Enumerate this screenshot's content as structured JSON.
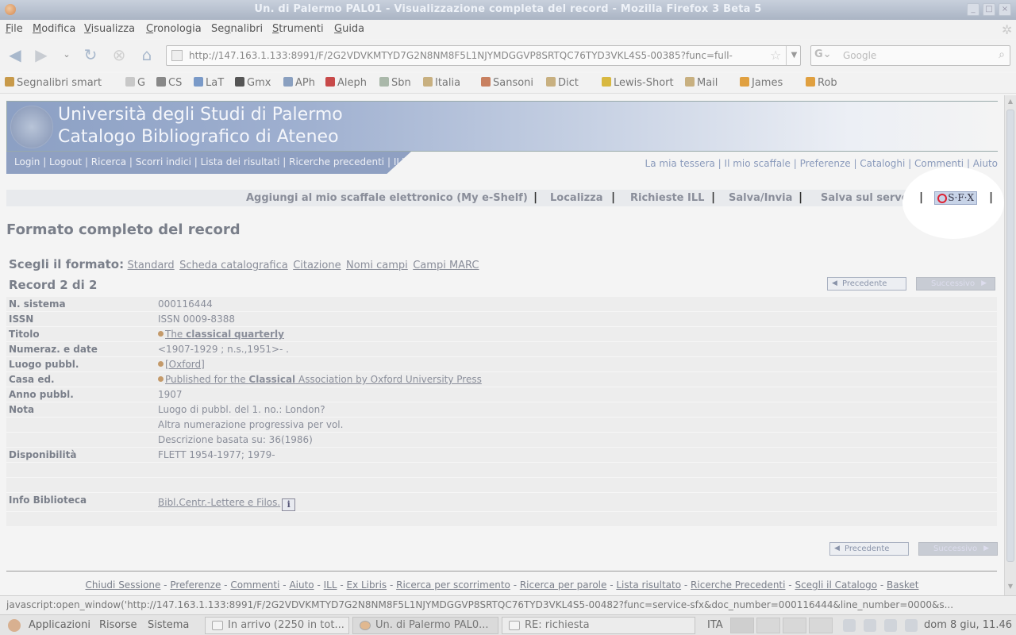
{
  "window": {
    "title": "Un. di Palermo PAL01 - Visualizzazione completa del record - Mozilla Firefox 3 Beta 5"
  },
  "menu": [
    "File",
    "Modifica",
    "Visualizza",
    "Cronologia",
    "Segnalibri",
    "Strumenti",
    "Guida"
  ],
  "menu_accel": [
    "F",
    "M",
    "V",
    "C",
    "g",
    "S",
    "G"
  ],
  "urlbar": {
    "url": "http://147.163.1.133:8991/F/2G2VDVKMTYD7G2N8NM8F5L1NJYMDGGVP8SRTQC76TYD3VKL4S5-00385?func=full-"
  },
  "searchbar": {
    "placeholder": "Google"
  },
  "bookmarks": [
    {
      "label": "Segnalibri smart",
      "icon": "bookmark-smart-icon",
      "color": "#c89a4a"
    },
    {
      "label": "G",
      "icon": "google-icon",
      "color": "#c8c8c8"
    },
    {
      "label": "CS",
      "icon": "cs-icon",
      "color": "#888888"
    },
    {
      "label": "LaT",
      "icon": "lat-icon",
      "color": "#7a9ac8"
    },
    {
      "label": "Gmx",
      "icon": "gmx-icon",
      "color": "#555555"
    },
    {
      "label": "APh",
      "icon": "aph-icon",
      "color": "#8aa0c0"
    },
    {
      "label": "Aleph",
      "icon": "aleph-icon",
      "color": "#c84a4a"
    },
    {
      "label": "Sbn",
      "icon": "sbn-icon",
      "color": "#aab8aa"
    },
    {
      "label": "Italia",
      "icon": "folder-icon",
      "color": "#c8b080"
    },
    {
      "label": "Sansoni",
      "icon": "sansoni-icon",
      "color": "#c88060"
    },
    {
      "label": "Dict",
      "icon": "folder-icon",
      "color": "#c8b080"
    },
    {
      "label": "Lewis-Short",
      "icon": "star-icon",
      "color": "#d8b840"
    },
    {
      "label": "Mail",
      "icon": "folder-icon",
      "color": "#c8b080"
    },
    {
      "label": "James",
      "icon": "rss-icon",
      "color": "#e0a040"
    },
    {
      "label": "Rob",
      "icon": "rss-icon",
      "color": "#e0a040"
    }
  ],
  "banner": {
    "line1": "Università degli Studi di Palermo",
    "line2": "Catalogo Bibliografico di Ateneo",
    "links": "Login |  Logout |  Ricerca |  Scorri indici |  Lista dei risultati |  Ricerche precedenti |  ILL",
    "toplinks": "La mia tessera |  Il mio scaffale |  Preferenze |  Cataloghi |  Commenti |  Aiuto"
  },
  "actions": {
    "eshelf": "Aggiungi al mio scaffale elettronico (My e-Shelf)",
    "localizza": "Localizza",
    "ill": "Richieste ILL",
    "salva": "Salva/Invia",
    "server": "Salva sul server",
    "sfx": "S·F·X",
    "sep": "|"
  },
  "page": {
    "title": "Formato completo del record",
    "format_label": "Scegli il formato:",
    "formats": [
      "Standard",
      "Scheda catalografica",
      "Citazione",
      "Nomi campi",
      "Campi MARC"
    ],
    "record": "Record 2 di 2",
    "prev": "Precedente",
    "next": "Successivo"
  },
  "record": {
    "n_sistema": {
      "k": "N. sistema",
      "v": "000116444"
    },
    "issn": {
      "k": "ISSN",
      "v": "ISSN 0009-8388"
    },
    "titolo": {
      "k": "Titolo",
      "a": "The ",
      "b1": "classical",
      "b2": "quarterly"
    },
    "numeraz": {
      "k": "Numeraz. e date",
      "v": "<1907-1929 ; n.s.,1951>- ."
    },
    "luogo": {
      "k": "Luogo pubbl.",
      "v": "[Oxford]"
    },
    "casa": {
      "k": "Casa ed.",
      "a": "Published for the ",
      "b": "Classical",
      "c": " Association by Oxford University Press"
    },
    "anno": {
      "k": "Anno pubbl.",
      "v": "1907"
    },
    "nota": {
      "k": "Nota",
      "v1": "Luogo di pubbl. del 1. no.: London?",
      "v2": "Altra numerazione progressiva per vol.",
      "v3": "Descrizione basata su: 36(1986)"
    },
    "disp": {
      "k": "Disponibilità",
      "v": "FLETT 1954-1977; 1979-"
    },
    "info": {
      "k": "Info Biblioteca",
      "v": "Bibl.Centr.-Lettere e Filos.",
      "icon": "i"
    }
  },
  "footer": [
    "Chiudi Sessione",
    "Preferenze",
    "Commenti",
    "Aiuto",
    "ILL",
    "Ex Libris",
    "Ricerca per scorrimento",
    "Ricerca per parole",
    "Lista risultato",
    "Ricerche Precedenti",
    "Scegli il Catalogo",
    "Basket"
  ],
  "status": "javascript:open_window('http://147.163.1.133:8991/F/2G2VDVKMTYD7G2N8NM8F5L1NJYMDGGVP8SRTQC76TYD3VKL4S5-00482?func=service-sfx&doc_number=000116444&line_number=0000&s...",
  "taskbar": {
    "apps": "Applicazioni",
    "places": "Risorse",
    "system": "Sistema",
    "task1": "In arrivo (2250 in tot...",
    "task2": "Un. di Palermo PAL0...",
    "task3": "RE: richiesta",
    "lang": "ITA",
    "clock": "dom  8 giu, 11.46"
  }
}
